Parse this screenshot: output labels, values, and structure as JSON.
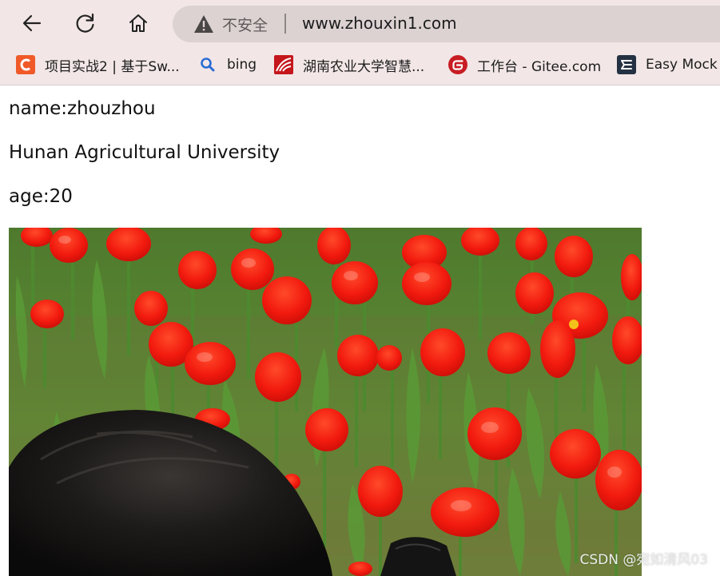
{
  "browser": {
    "address_bar": {
      "security_label": "不安全",
      "url": "www.zhouxin1.com"
    },
    "bookmarks": [
      {
        "label": "项目实战2 | 基于Sw...",
        "icon": "csdn-logo-icon",
        "color": "#f05a28"
      },
      {
        "label": "bing",
        "icon": "search-icon",
        "color": "#2b6cd4"
      },
      {
        "label": "湖南农业大学智慧...",
        "icon": "university-logo-icon",
        "color": "#c4161c"
      },
      {
        "label": "工作台 - Gitee.com",
        "icon": "gitee-logo-icon",
        "color": "#c71d23"
      },
      {
        "label": "Easy Mock",
        "icon": "easymock-logo-icon",
        "color": "#233142"
      }
    ]
  },
  "page": {
    "name_line": "name:zhouzhou",
    "school_line": "Hunan Agricultural University",
    "age_line": "age:20",
    "photo": {
      "description_icon": "tulip-field-photo",
      "watermark": "CSDN @宛如清风03"
    }
  }
}
